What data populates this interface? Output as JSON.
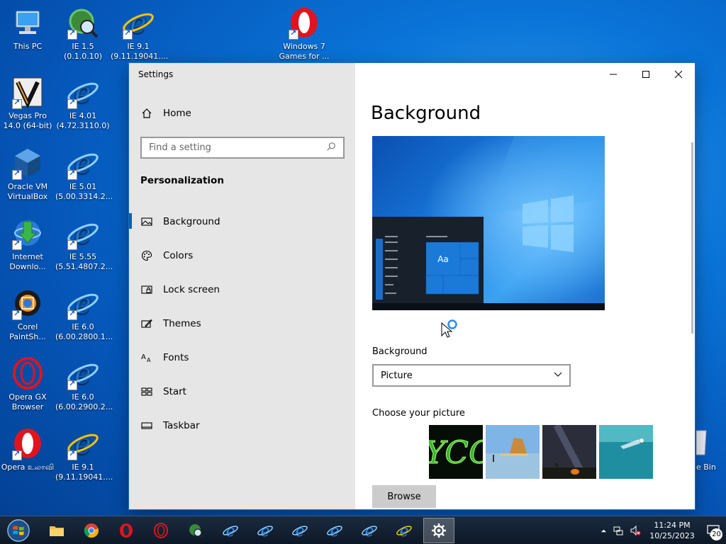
{
  "desktop": {
    "icons": [
      {
        "label": "This PC",
        "icon": "computer-icon"
      },
      {
        "label": "IE 1.5 (0.1.0.10)",
        "icon": "ie-old-icon"
      },
      {
        "label": "IE 9.1 (9.11.19041....",
        "icon": "ie-icon"
      },
      {
        "label": "Windows 7 Games for ...",
        "icon": "opera-icon"
      },
      {
        "label": "Vegas Pro 14.0 (64-bit)",
        "icon": "vegas-icon"
      },
      {
        "label": "IE 4.01 (4.72.3110.0)",
        "icon": "ie-icon"
      },
      {
        "label": "Oracle VM VirtualBox",
        "icon": "virtualbox-icon"
      },
      {
        "label": "IE 5.01 (5.00.3314.2...",
        "icon": "ie-icon"
      },
      {
        "label": "Internet Downlo...",
        "icon": "idm-icon"
      },
      {
        "label": "IE 5.55 (5.51.4807.2...",
        "icon": "ie-icon"
      },
      {
        "label": "Corel PaintSh...",
        "icon": "corel-icon"
      },
      {
        "label": "IE 6.0 (6.00.2800.1...",
        "icon": "ie-icon"
      },
      {
        "label": "Opera GX Browser",
        "icon": "opera-gx-icon"
      },
      {
        "label": "IE 6.0 (6.00.2900.2...",
        "icon": "ie-icon"
      },
      {
        "label": "Opera உலாவி",
        "icon": "opera-icon"
      },
      {
        "label": "IE 9.1 (9.11.19041....",
        "icon": "ie-icon"
      }
    ],
    "recycle_bin_label": "e Bin"
  },
  "window": {
    "title": "Settings",
    "home_label": "Home",
    "search_placeholder": "Find a setting",
    "section": "Personalization",
    "nav": [
      {
        "label": "Background",
        "icon": "picture-icon",
        "active": true
      },
      {
        "label": "Colors",
        "icon": "palette-icon"
      },
      {
        "label": "Lock screen",
        "icon": "lock-screen-icon"
      },
      {
        "label": "Themes",
        "icon": "themes-icon"
      },
      {
        "label": "Fonts",
        "icon": "fonts-icon"
      },
      {
        "label": "Start",
        "icon": "start-icon"
      },
      {
        "label": "Taskbar",
        "icon": "taskbar-icon"
      }
    ],
    "page_title": "Background",
    "preview_tile_text": "Aa",
    "background_label": "Background",
    "background_value": "Picture",
    "choose_picture_label": "Choose your picture",
    "browse_label": "Browse"
  },
  "taskbar": {
    "apps": [
      "explorer-icon",
      "chrome-icon",
      "opera-icon",
      "opera-gx-icon",
      "ie-old-icon",
      "ie-icon",
      "ie-icon",
      "ie-icon",
      "ie-icon",
      "ie-icon",
      "ie-icon",
      "settings-icon"
    ],
    "time": "11:24 PM",
    "date": "10/25/2023",
    "notification_count": "20"
  },
  "colors": {
    "accent": "#0063b1",
    "sidebar": "#e6e6e6",
    "taskbar": "#142236"
  }
}
